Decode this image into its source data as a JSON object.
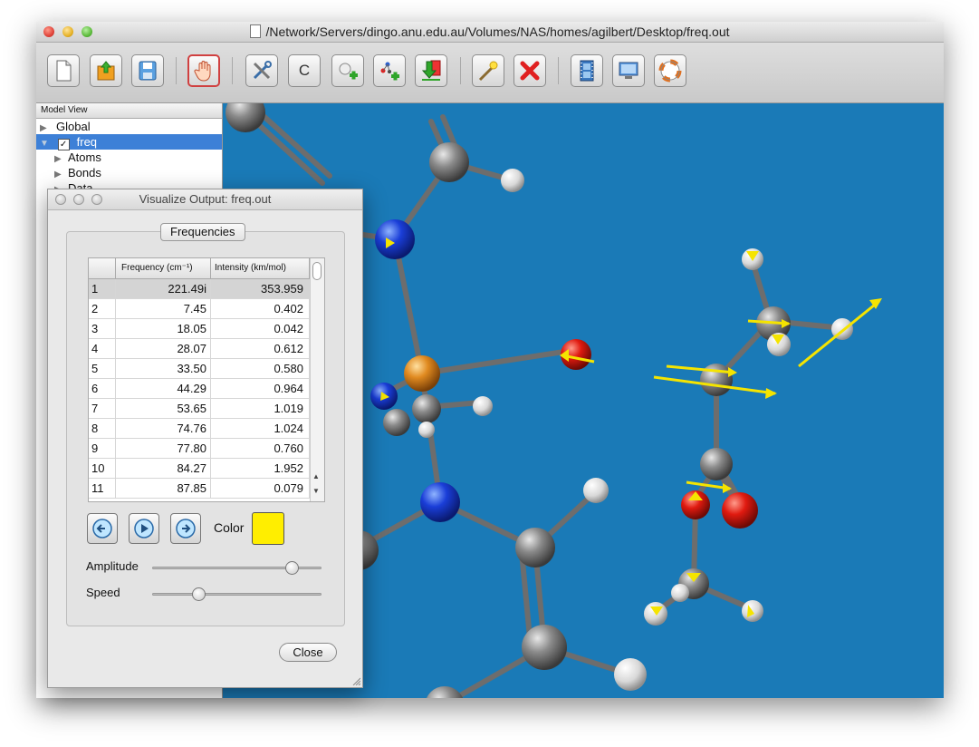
{
  "window": {
    "title": "/Network/Servers/dingo.anu.edu.au/Volumes/NAS/homes/agilbert/Desktop/freq.out"
  },
  "toolbar": {
    "buttons": [
      "new-file-icon",
      "open-file-icon",
      "save-icon",
      "hand-tool-icon",
      "build-tools-icon",
      "carbon-element",
      "add-atom-icon",
      "add-fragment-icon",
      "import-icon",
      "wand-icon",
      "delete-icon",
      "film-icon",
      "monitor-icon",
      "help-lifebuoy-icon"
    ],
    "carbon_label": "C"
  },
  "model_view": {
    "header": "Model View",
    "items": [
      {
        "label": "Global",
        "expanded": false
      },
      {
        "label": "freq",
        "expanded": true,
        "checked": true,
        "selected": true
      },
      {
        "label": "Atoms",
        "expanded": false
      },
      {
        "label": "Bonds",
        "expanded": false
      },
      {
        "label": "Data",
        "expanded": false
      }
    ]
  },
  "dialog": {
    "title": "Visualize Output: freq.out",
    "group_label": "Frequencies",
    "table": {
      "columns": [
        "",
        "Frequency (cm⁻¹)",
        "Intensity (km/mol)"
      ],
      "rows": [
        [
          "1",
          "221.49i",
          "353.959"
        ],
        [
          "2",
          "7.45",
          "0.402"
        ],
        [
          "3",
          "18.05",
          "0.042"
        ],
        [
          "4",
          "28.07",
          "0.612"
        ],
        [
          "5",
          "33.50",
          "0.580"
        ],
        [
          "6",
          "44.29",
          "0.964"
        ],
        [
          "7",
          "53.65",
          "1.019"
        ],
        [
          "8",
          "74.76",
          "1.024"
        ],
        [
          "9",
          "77.80",
          "0.760"
        ],
        [
          "10",
          "84.27",
          "1.952"
        ],
        [
          "11",
          "87.85",
          "0.079"
        ]
      ],
      "selected_row": 1
    },
    "color_label": "Color",
    "color_value": "#ffee00",
    "amplitude_label": "Amplitude",
    "amplitude_value": 0.82,
    "speed_label": "Speed",
    "speed_value": 0.27,
    "close_label": "Close"
  },
  "colors": {
    "viewport_bg": "#1a7ab7",
    "vector_arrow": "#ffee00",
    "selection": "#3d80d7"
  }
}
